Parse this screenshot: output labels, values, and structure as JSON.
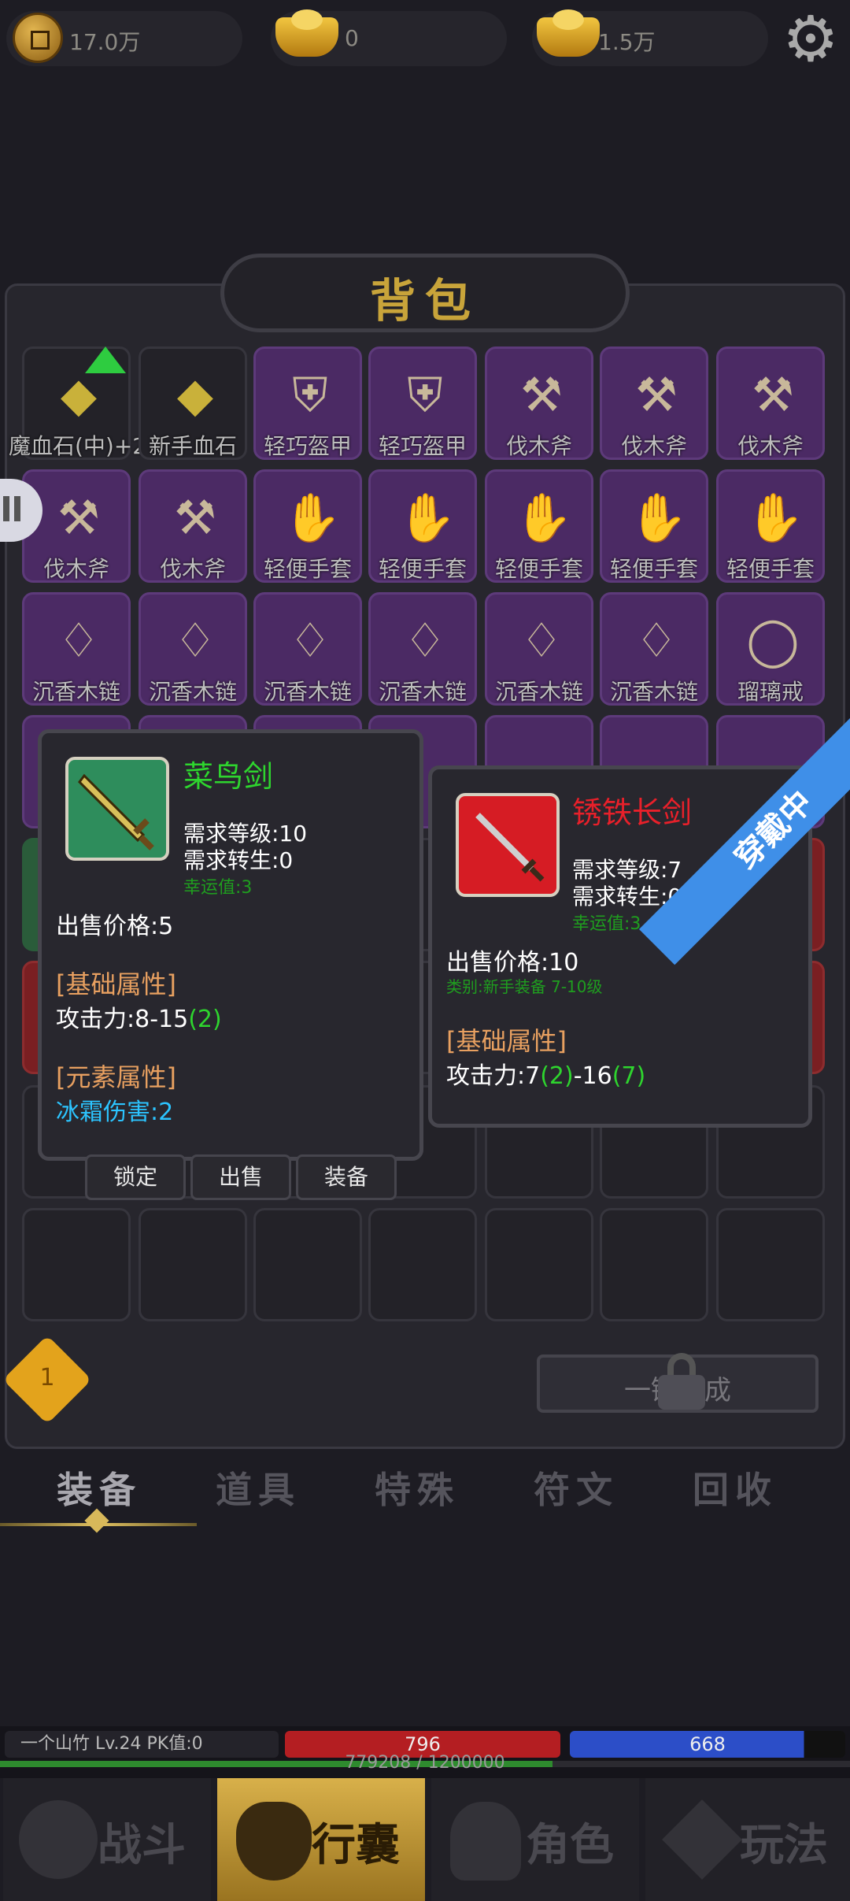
{
  "currency": {
    "gold": "17.0万",
    "ingot": "0",
    "ingot2": "1.5万"
  },
  "bag": {
    "title": "背包",
    "grid_row1": [
      "魔血石(中)+2",
      "新手血石",
      "轻巧盔甲",
      "轻巧盔甲",
      "伐木斧",
      "伐木斧",
      "伐木斧"
    ],
    "grid_row2": [
      "伐木斧",
      "伐木斧",
      "轻便手套",
      "轻便手套",
      "轻便手套",
      "轻便手套",
      "轻便手套"
    ],
    "grid_row3": [
      "沉香木链",
      "沉香木链",
      "沉香木链",
      "沉香木链",
      "沉香木链",
      "沉香木链",
      "瑠璃戒"
    ],
    "one_click_label": "一键合成",
    "lock_count": "1"
  },
  "tooltip_selected": {
    "name": "菜鸟剑",
    "req_level": "需求等级:10",
    "req_rebirth": "需求转生:0",
    "luck": "幸运值:3",
    "sell_price": "出售价格:5",
    "base_header": "[基础属性]",
    "attack_prefix": "攻击力:8-15",
    "attack_bonus": "(2)",
    "element_header": "[元素属性]",
    "frost": "冰霜伤害:2",
    "buttons": {
      "lock": "锁定",
      "sell": "出售",
      "equip": "装备"
    }
  },
  "tooltip_equipped": {
    "name": "锈铁长剑",
    "req_level": "需求等级:7",
    "req_rebirth": "需求转生:0",
    "luck": "幸运值:3",
    "sell_price": "出售价格:10",
    "category": "类别:新手装备  7-10级",
    "base_header": "[基础属性]",
    "attack_a": "攻击力:7",
    "attack_b": "(2)",
    "attack_c": "-16",
    "attack_d": "(7)",
    "ribbon": "穿戴中"
  },
  "tabs": [
    "装备",
    "道具",
    "特殊",
    "符文",
    "回收"
  ],
  "status": {
    "player": "一个山竹   Lv.24 PK值:0",
    "hp": "796",
    "mp": "668",
    "exp": "779208 / 1200000"
  },
  "nav": [
    "战斗",
    "行囊",
    "角色",
    "玩法"
  ],
  "colors": {
    "green": "#2ed52e",
    "red": "#e8202a",
    "luck": "#1f9e1f",
    "orange": "#e8a060",
    "frost": "#2cc4ff",
    "blue_ribbon": "#3f8fe8"
  }
}
